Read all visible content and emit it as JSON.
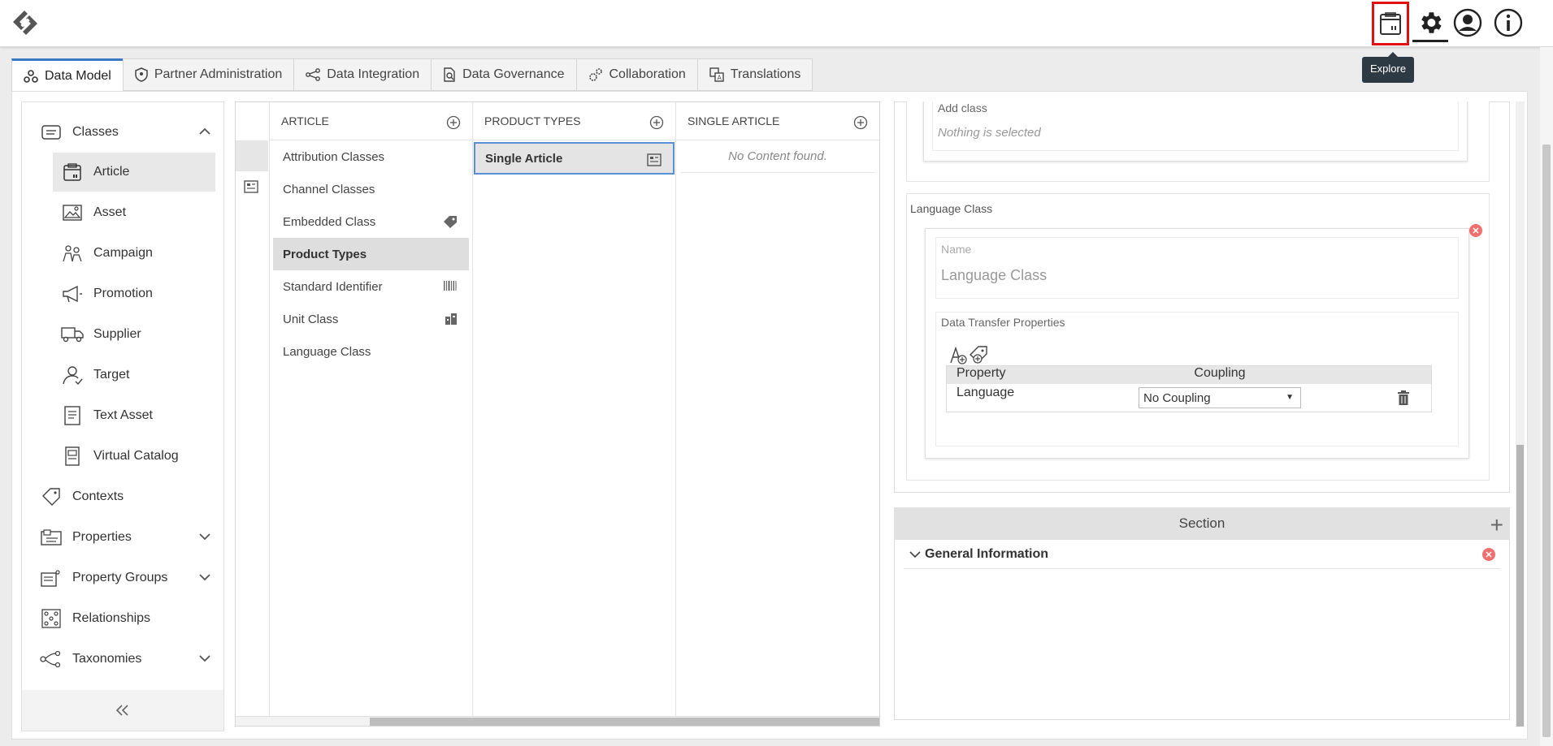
{
  "header": {
    "explore_tooltip": "Explore"
  },
  "tabs": [
    {
      "label": "Data Model",
      "active": true
    },
    {
      "label": "Partner Administration"
    },
    {
      "label": "Data Integration"
    },
    {
      "label": "Data Governance"
    },
    {
      "label": "Collaboration"
    },
    {
      "label": "Translations"
    }
  ],
  "sidebar": {
    "items": [
      {
        "label": "Classes",
        "level": "top",
        "icon": "classes-icon",
        "chevron": "up"
      },
      {
        "label": "Article",
        "level": "sub",
        "icon": "article-icon",
        "selected": true
      },
      {
        "label": "Asset",
        "level": "sub",
        "icon": "asset-icon"
      },
      {
        "label": "Campaign",
        "level": "sub",
        "icon": "campaign-icon"
      },
      {
        "label": "Promotion",
        "level": "sub",
        "icon": "promotion-icon"
      },
      {
        "label": "Supplier",
        "level": "sub",
        "icon": "supplier-icon"
      },
      {
        "label": "Target",
        "level": "sub",
        "icon": "target-icon"
      },
      {
        "label": "Text Asset",
        "level": "sub",
        "icon": "text-asset-icon"
      },
      {
        "label": "Virtual Catalog",
        "level": "sub",
        "icon": "virtual-catalog-icon"
      },
      {
        "label": "Contexts",
        "level": "top",
        "icon": "contexts-icon"
      },
      {
        "label": "Properties",
        "level": "top",
        "icon": "properties-icon",
        "chevron": "down"
      },
      {
        "label": "Property Groups",
        "level": "top",
        "icon": "property-groups-icon",
        "chevron": "down"
      },
      {
        "label": "Relationships",
        "level": "top",
        "icon": "relationships-icon"
      },
      {
        "label": "Taxonomies",
        "level": "top",
        "icon": "taxonomies-icon",
        "chevron": "down"
      }
    ]
  },
  "columns": {
    "article": {
      "header": "ARTICLE",
      "rows": [
        {
          "label": "Attribution Classes"
        },
        {
          "label": "Channel Classes"
        },
        {
          "label": "Embedded Class",
          "icon": "tag-icon"
        },
        {
          "label": "Product Types",
          "selected": true
        },
        {
          "label": "Standard Identifier",
          "icon": "barcode-icon"
        },
        {
          "label": "Unit Class",
          "icon": "unit-icon"
        },
        {
          "label": "Language Class"
        }
      ]
    },
    "product_types": {
      "header": "PRODUCT TYPES",
      "rows": [
        {
          "label": "Single Article",
          "icon": "form-icon",
          "selected": true
        }
      ]
    },
    "single_article": {
      "header": "SINGLE ARTICLE",
      "empty": "No Content found."
    }
  },
  "detail": {
    "add_class_label": "Add class",
    "add_class_value": "Nothing is selected",
    "language_class_title": "Language Class",
    "name_label": "Name",
    "name_value": "Language Class",
    "dtp_title": "Data Transfer Properties",
    "table": {
      "headers": [
        "Property",
        "Coupling"
      ],
      "rows": [
        {
          "property": "Language",
          "coupling": "No Coupling"
        }
      ]
    },
    "section_header": "Section",
    "section_item": "General Information"
  },
  "colors": {
    "accent": "#3a78c5",
    "highlight_border": "#e01010",
    "close_red": "#f07070"
  }
}
